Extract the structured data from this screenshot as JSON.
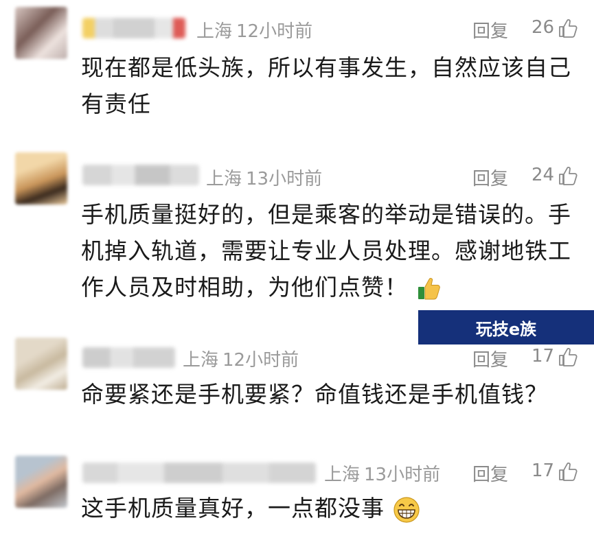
{
  "comments": [
    {
      "location": "上海",
      "time": "12小时前",
      "reply_label": "回复",
      "likes": "26",
      "text": "现在都是低头族，所以有事发生，自然应该自己有责任"
    },
    {
      "location": "上海",
      "time": "13小时前",
      "reply_label": "回复",
      "likes": "24",
      "text": "手机质量挺好的，但是乘客的举动是错误的。手机掉入轨道，需要让专业人员处理。感谢地铁工作人员及时相助，为他们点赞！",
      "emoji": "thumbs-up-emoji"
    },
    {
      "location": "上海",
      "time": "12小时前",
      "reply_label": "回复",
      "likes": "17",
      "text": "命要紧还是手机要紧？命值钱还是手机值钱？"
    },
    {
      "location": "上海",
      "time": "13小时前",
      "reply_label": "回复",
      "likes": "17",
      "text": "这手机质量真好，一点都没事",
      "emoji": "grinning-face-emoji"
    }
  ],
  "watermark": {
    "text": "玩技e族",
    "background": "#15307a"
  },
  "icons": {
    "like": "thumbs-up-outline-icon"
  }
}
